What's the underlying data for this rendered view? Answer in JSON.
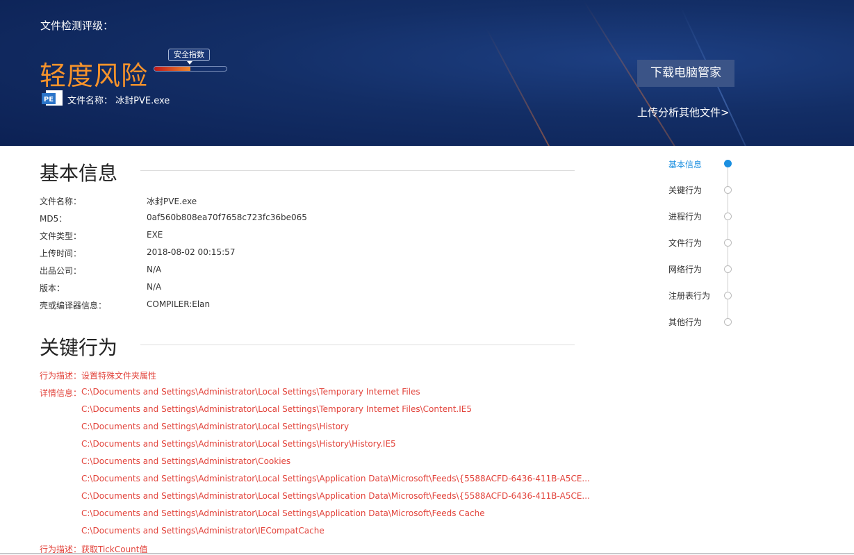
{
  "header": {
    "label": "文件检测评级：",
    "risk_level": "轻度风险",
    "score_tag": "安全指数",
    "score_fraction": 0.5,
    "file_label": "文件名称：",
    "file_name": "冰封PVE.exe",
    "file_icon_text": "PE",
    "download_button": "下载电脑管家",
    "upload_link": "上传分析其他文件>"
  },
  "colors": {
    "risk": "#f7932b",
    "accent": "#1b8fe0",
    "behavior_red": "#e2433b",
    "header_bg": "#132e66"
  },
  "basic": {
    "title": "基本信息",
    "rows": [
      {
        "label": "文件名称：",
        "value": "冰封PVE.exe"
      },
      {
        "label": "MD5：",
        "value": "0af560b808ea70f7658c723fc36be065"
      },
      {
        "label": "文件类型：",
        "value": "EXE"
      },
      {
        "label": "上传时间：",
        "value": "2018-08-02 00:15:57"
      },
      {
        "label": "出品公司：",
        "value": "N/A"
      },
      {
        "label": "版本：",
        "value": "N/A"
      },
      {
        "label": "壳或编译器信息：",
        "value": "COMPILER:Elan"
      }
    ]
  },
  "behavior": {
    "title": "关键行为",
    "desc1_label": "行为描述：",
    "desc1_value": "设置特殊文件夹属性",
    "detail_label": "详情信息：",
    "details": [
      "C:\\Documents and Settings\\Administrator\\Local Settings\\Temporary Internet Files",
      "C:\\Documents and Settings\\Administrator\\Local Settings\\Temporary Internet Files\\Content.IE5",
      "C:\\Documents and Settings\\Administrator\\Local Settings\\History",
      "C:\\Documents and Settings\\Administrator\\Local Settings\\History\\History.IE5",
      "C:\\Documents and Settings\\Administrator\\Cookies",
      "C:\\Documents and Settings\\Administrator\\Local Settings\\Application Data\\Microsoft\\Feeds\\{5588ACFD-6436-411B-A5CE...",
      "C:\\Documents and Settings\\Administrator\\Local Settings\\Application Data\\Microsoft\\Feeds\\{5588ACFD-6436-411B-A5CE...",
      "C:\\Documents and Settings\\Administrator\\Local Settings\\Application Data\\Microsoft\\Feeds Cache",
      "C:\\Documents and Settings\\Administrator\\IECompatCache"
    ],
    "desc2_label": "行为描述：",
    "desc2_value": "获取TickCount值"
  },
  "timeline": {
    "items": [
      "基本信息",
      "关键行为",
      "进程行为",
      "文件行为",
      "网络行为",
      "注册表行为",
      "其他行为"
    ],
    "active_index": 0
  }
}
